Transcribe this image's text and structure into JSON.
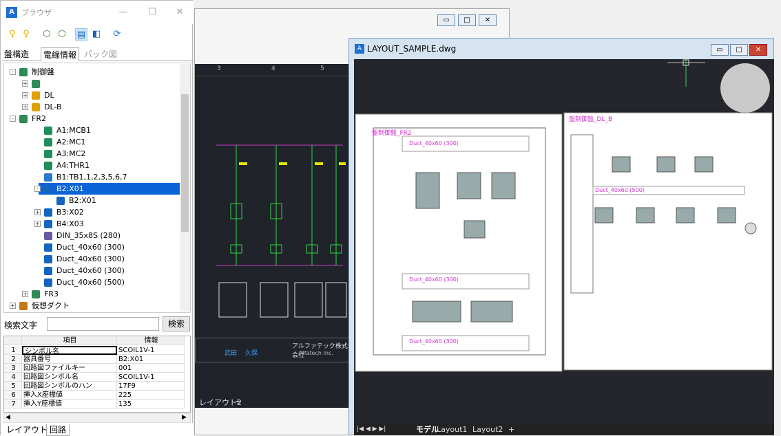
{
  "browser": {
    "title": "ブラウザ",
    "tabs": [
      "盤構造",
      "電線情報",
      "パック図"
    ],
    "tree": [
      {
        "label": "制御盤",
        "indent": 0,
        "pm": "-",
        "icon": "panel"
      },
      {
        "label": "",
        "indent": 1,
        "pm": "+",
        "icon": "panel"
      },
      {
        "label": "DL",
        "indent": 1,
        "pm": "+",
        "icon": "panel-folder"
      },
      {
        "label": "DL-B",
        "indent": 1,
        "pm": "+",
        "icon": "panel-folder"
      },
      {
        "label": "FR2",
        "indent": 0,
        "pm": "-",
        "icon": "panel"
      },
      {
        "label": "A1:MCB1",
        "indent": 2,
        "pm": "",
        "icon": "part"
      },
      {
        "label": "A2:MC1",
        "indent": 2,
        "pm": "",
        "icon": "part"
      },
      {
        "label": "A3:MC2",
        "indent": 2,
        "pm": "",
        "icon": "part"
      },
      {
        "label": "A4:THR1",
        "indent": 2,
        "pm": "",
        "icon": "part"
      },
      {
        "label": "B1:TB1,1,2,3,5,6,7",
        "indent": 2,
        "pm": "",
        "icon": "terminal"
      },
      {
        "label": "B2:X01",
        "indent": 2,
        "pm": "-",
        "icon": "relay",
        "selected": true
      },
      {
        "label": "B2:X01",
        "indent": 3,
        "pm": "",
        "icon": "pen"
      },
      {
        "label": "B3:X02",
        "indent": 2,
        "pm": "+",
        "icon": "relay"
      },
      {
        "label": "B4:X03",
        "indent": 2,
        "pm": "+",
        "icon": "relay"
      },
      {
        "label": "DIN_35x8S (280)",
        "indent": 2,
        "pm": "",
        "icon": "din"
      },
      {
        "label": "Duct_40x60 (300)",
        "indent": 2,
        "pm": "",
        "icon": "duct"
      },
      {
        "label": "Duct_40x60 (300)",
        "indent": 2,
        "pm": "",
        "icon": "duct"
      },
      {
        "label": "Duct_40x60 (300)",
        "indent": 2,
        "pm": "",
        "icon": "duct"
      },
      {
        "label": "Duct_40x60 (500)",
        "indent": 2,
        "pm": "",
        "icon": "duct"
      },
      {
        "label": "FR3",
        "indent": 1,
        "pm": "+",
        "icon": "panel"
      },
      {
        "label": "仮想ダクト",
        "indent": 0,
        "pm": "+",
        "icon": "virtual"
      }
    ],
    "search": {
      "label": "検索文字",
      "button": "検索",
      "value": ""
    },
    "grid": {
      "headers": [
        "",
        "項目",
        "情報"
      ],
      "rows": [
        [
          "1",
          "シンボル名",
          "SCOIL1V-1"
        ],
        [
          "2",
          "器具番号",
          "B2:X01"
        ],
        [
          "3",
          "回路図ファイルキー",
          "001"
        ],
        [
          "4",
          "回路図シンボル名",
          "SCOIL1V-1"
        ],
        [
          "5",
          "回路図シンボルのハン",
          "17F9"
        ],
        [
          "6",
          "挿入X座標値",
          "225"
        ],
        [
          "7",
          "挿入Y座標値",
          "135"
        ]
      ]
    },
    "bottom_tabs": [
      "レイアウト",
      "回路"
    ]
  },
  "win2": {
    "ruler": [
      "3",
      "4",
      "5"
    ],
    "tab": "レイアウト2",
    "plus": "+",
    "stamp": {
      "company": "アルファテック株式会社",
      "sub": "Alfatech Inc.",
      "names": [
        "武田",
        "久保"
      ]
    }
  },
  "win3": {
    "title": "LAYOUT_SAMPLE.dwg",
    "cad_labels": {
      "left_panel": "盤制御盤_FR2",
      "right_panel": "盤制御盤_DL_B",
      "duct1": "Duct_40x60 (300)",
      "duct2": "Duct_40x60 (300)",
      "duct3": "Duct_40x60 (300)",
      "duct4": "Duct_40x60 (500)"
    },
    "tabs": [
      "モデル",
      "Layout1",
      "Layout2",
      "+"
    ]
  }
}
